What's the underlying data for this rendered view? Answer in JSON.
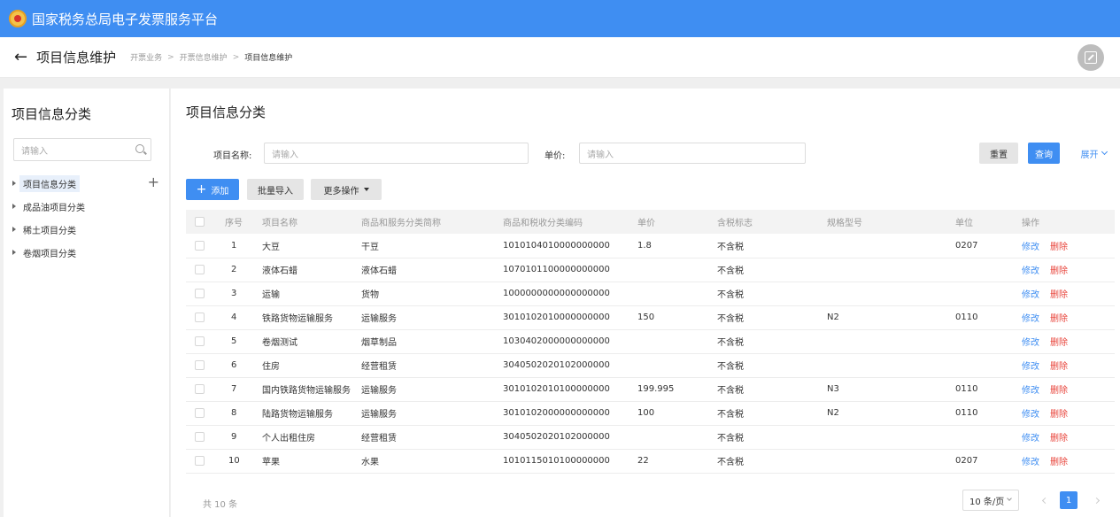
{
  "app": {
    "title": "国家税务总局电子发票服务平台"
  },
  "header": {
    "back_icon": "left-arrow-icon",
    "page_title": "项目信息维护",
    "breadcrumb": [
      "开票业务",
      "开票信息维护",
      "项目信息维护"
    ],
    "breadcrumb_sep": ">",
    "expand_icon": "fullscreen-icon"
  },
  "sidebar": {
    "title": "项目信息分类",
    "search_placeholder": "请输入",
    "items": [
      {
        "label": "项目信息分类",
        "active": true
      },
      {
        "label": "成品油项目分类",
        "active": false
      },
      {
        "label": "稀土项目分类",
        "active": false
      },
      {
        "label": "卷烟项目分类",
        "active": false
      }
    ],
    "add_symbol": "+"
  },
  "main": {
    "title": "项目信息分类",
    "filters": {
      "name_label": "项目名称:",
      "name_placeholder": "请输入",
      "price_label": "单价:",
      "price_placeholder": "请输入"
    },
    "actions": {
      "reset": "重置",
      "query": "查询",
      "expand": "展开",
      "add": "添加",
      "add_symbol": "+",
      "import": "批量导入",
      "more": "更多操作"
    },
    "table": {
      "columns": [
        "序号",
        "项目名称",
        "商品和服务分类简称",
        "商品和税收分类编码",
        "单价",
        "含税标志",
        "规格型号",
        "单位",
        "操作"
      ],
      "op_edit": "修改",
      "op_delete": "删除",
      "rows": [
        {
          "no": "1",
          "name": "大豆",
          "category": "干豆",
          "code": "1010104010000000000",
          "price": "1.8",
          "tax_flag": "不含税",
          "spec": "",
          "unit": "0207"
        },
        {
          "no": "2",
          "name": "液体石蜡",
          "category": "液体石蜡",
          "code": "1070101100000000000",
          "price": "",
          "tax_flag": "不含税",
          "spec": "",
          "unit": ""
        },
        {
          "no": "3",
          "name": "运输",
          "category": "货物",
          "code": "1000000000000000000",
          "price": "",
          "tax_flag": "不含税",
          "spec": "",
          "unit": ""
        },
        {
          "no": "4",
          "name": "铁路货物运输服务",
          "category": "运输服务",
          "code": "3010102010000000000",
          "price": "150",
          "tax_flag": "不含税",
          "spec": "N2",
          "unit": "0110"
        },
        {
          "no": "5",
          "name": "卷烟测试",
          "category": "烟草制品",
          "code": "1030402000000000000",
          "price": "",
          "tax_flag": "不含税",
          "spec": "",
          "unit": ""
        },
        {
          "no": "6",
          "name": "住房",
          "category": "经营租赁",
          "code": "3040502020102000000",
          "price": "",
          "tax_flag": "不含税",
          "spec": "",
          "unit": ""
        },
        {
          "no": "7",
          "name": "国内铁路货物运输服务",
          "category": "运输服务",
          "code": "3010102010100000000",
          "price": "199.995",
          "tax_flag": "不含税",
          "spec": "N3",
          "unit": "0110"
        },
        {
          "no": "8",
          "name": "陆路货物运输服务",
          "category": "运输服务",
          "code": "3010102000000000000",
          "price": "100",
          "tax_flag": "不含税",
          "spec": "N2",
          "unit": "0110"
        },
        {
          "no": "9",
          "name": "个人出租住房",
          "category": "经营租赁",
          "code": "3040502020102000000",
          "price": "",
          "tax_flag": "不含税",
          "spec": "",
          "unit": ""
        },
        {
          "no": "10",
          "name": "苹果",
          "category": "水果",
          "code": "1010115010100000000",
          "price": "22",
          "tax_flag": "不含税",
          "spec": "",
          "unit": "0207"
        }
      ]
    },
    "pagination": {
      "total": "共 10 条",
      "page_size": "10 条/页",
      "current_page": "1"
    }
  },
  "colors": {
    "primary": "#3f8ef2",
    "danger": "#e8433a"
  }
}
